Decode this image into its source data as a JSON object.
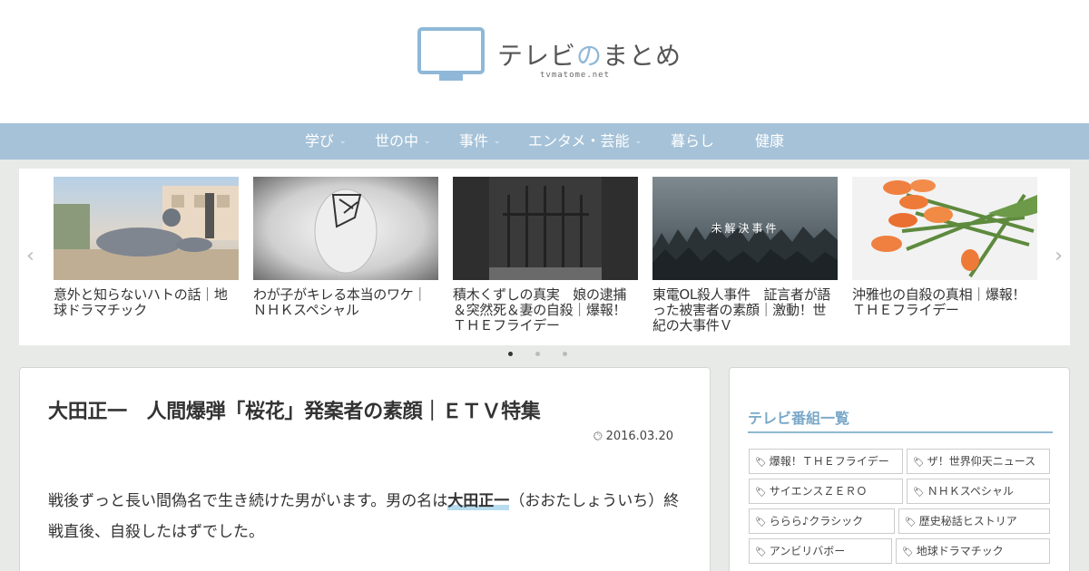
{
  "site": {
    "logo_text": "テレビ",
    "logo_accent": "の",
    "logo_rest": "まとめ",
    "logo_sub": "tvmatome.net"
  },
  "nav": [
    {
      "label": "学び",
      "has_dropdown": true
    },
    {
      "label": "世の中",
      "has_dropdown": true
    },
    {
      "label": "事件",
      "has_dropdown": true
    },
    {
      "label": "エンタメ・芸能",
      "has_dropdown": true
    },
    {
      "label": "暮らし",
      "has_dropdown": false
    },
    {
      "label": "健康",
      "has_dropdown": false
    }
  ],
  "carousel": {
    "cards": [
      {
        "title": "意外と知らないハトの話｜地球ドラマチック",
        "image": "pigeon-photo"
      },
      {
        "title": "わが子がキレる本当のワケ｜ＮＨＫスペシャル",
        "image": "mannequin-head-photo"
      },
      {
        "title": "積木くずしの真実　娘の逮捕＆突然死＆妻の自殺｜爆報！ＴＨＥフライデー",
        "image": "prison-bars-photo"
      },
      {
        "title": "東電OL殺人事件　証言者が語った被害者の素顔｜激動！世紀の大事件Ｖ",
        "image": "misty-forest-photo",
        "overlay": "未解決事件"
      },
      {
        "title": "沖雅也の自殺の真相｜爆報！ＴＨＥフライデー",
        "image": "tulips-photo"
      }
    ],
    "dots": 3,
    "active_dot": 0
  },
  "article": {
    "title": "大田正一　人間爆弾「桜花」発案者の素顔｜ＥＴＶ特集",
    "date": "2016.03.20",
    "body_before": "戦後ずっと長い間偽名で生き続けた男がいます。男の名は",
    "body_highlight": "大田正一",
    "body_after": "（おおたしょういち）終戦直後、自殺したはずでした。"
  },
  "sidebar": {
    "heading": "テレビ番組一覧",
    "tags": [
      "爆報！ＴＨＥフライデー",
      "ザ！世界仰天ニュース",
      "サイエンスＺＥＲＯ",
      "ＮＨＫスペシャル",
      "ららら♪クラシック",
      "歴史秘話ヒストリア",
      "アンビリバボー",
      "地球ドラマチック"
    ]
  },
  "colors": {
    "nav_bg": "#a5c2d8",
    "accent": "#8fb8d8",
    "highlight": "#b8dcef"
  }
}
